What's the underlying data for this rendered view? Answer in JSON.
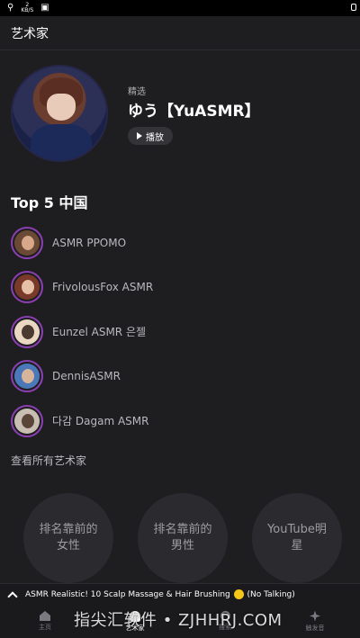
{
  "status_bar": {
    "net_value": "2",
    "net_unit": "KB/S"
  },
  "header": {
    "title": "艺术家"
  },
  "featured": {
    "label": "精选",
    "name": "ゆう【YuASMR】",
    "play_label": "播放"
  },
  "top5": {
    "title": "Top 5 中国",
    "items": [
      {
        "label": "ASMR PPOMO"
      },
      {
        "label": "FrivolousFox ASMR"
      },
      {
        "label": "Eunzel ASMR 은젤"
      },
      {
        "label": "DennisASMR"
      },
      {
        "label": "다감 Dagam ASMR"
      }
    ],
    "see_all": "查看所有艺术家"
  },
  "categories": [
    {
      "label": "排名靠前的女性"
    },
    {
      "label": "排名靠前的男性"
    },
    {
      "label": "YouTube明星"
    }
  ],
  "mini_player": {
    "title_before": "ASMR Realistic! 10 Scalp Massage & Hair Brushing",
    "title_after": "(No Talking)"
  },
  "nav": {
    "items": [
      {
        "label": "主页",
        "icon": "home-icon"
      },
      {
        "label": "艺术家",
        "icon": "artist-icon"
      },
      {
        "label": "搜索",
        "icon": "search-icon"
      },
      {
        "label": "触发音",
        "icon": "sparkle-icon"
      }
    ]
  },
  "watermark": {
    "text": "指尖汇软件 • ZJHHRJ.COM"
  },
  "colors": {
    "background": "#1e1e21",
    "avatar_ring": "#8b3fb3",
    "circle_bg": "#2b2b2f",
    "muted_text": "#b9b9be"
  }
}
